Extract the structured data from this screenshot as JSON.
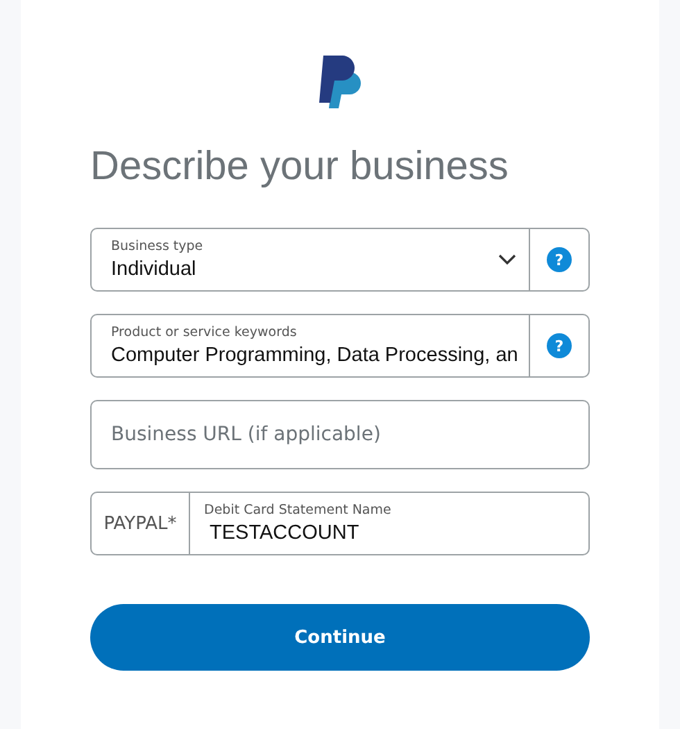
{
  "title": "Describe your business",
  "fields": [
    {
      "kind": "select",
      "label": "Business type",
      "value": "Individual",
      "help": "?"
    },
    {
      "kind": "text",
      "label": "Product or service keywords",
      "value": "Computer Programming, Data Processing, an",
      "help": "?"
    },
    {
      "kind": "text",
      "placeholder": "Business URL (if applicable)"
    },
    {
      "kind": "prefixed",
      "prefix": "PAYPAL*",
      "label": "Debit Card Statement Name",
      "value": "TESTACCOUNT"
    }
  ],
  "button": "Continue"
}
